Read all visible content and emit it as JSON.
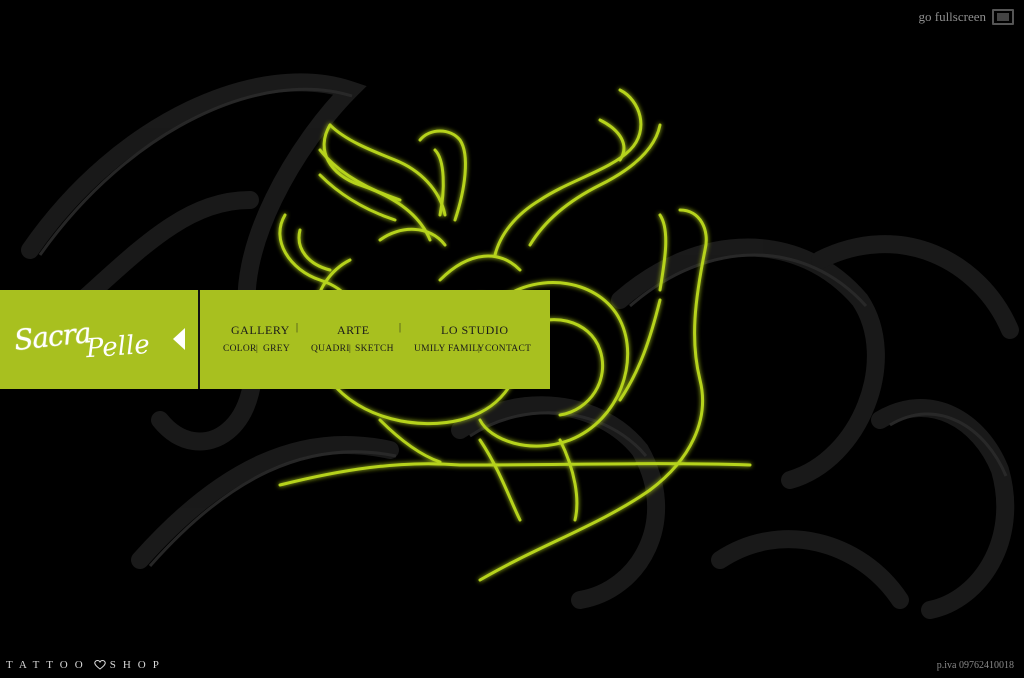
{
  "top": {
    "fullscreen_label": "go fullscreen",
    "fullscreen_icon": "fullscreen-icon"
  },
  "logo": {
    "line1": "Sacra",
    "line2": "Pelle"
  },
  "nav": {
    "main": [
      {
        "label": "GALLERY"
      },
      {
        "label": "ARTE"
      },
      {
        "label": "LO STUDIO"
      }
    ],
    "sub": [
      {
        "label": "COLOR"
      },
      {
        "label": "GREY"
      },
      {
        "label": "QUADRI"
      },
      {
        "label": "SKETCH"
      },
      {
        "label": "UMILY FAMILY"
      },
      {
        "label": "CONTACT"
      }
    ],
    "separator": "|"
  },
  "footer": {
    "left_part1": "TATTOO",
    "left_part2": "SHOP",
    "left_icon": "heart-icon",
    "vat": "p.iva 09762410018"
  },
  "colors": {
    "accent": "#a8c01f",
    "background": "#000000",
    "art_line": "#b6d31e"
  }
}
